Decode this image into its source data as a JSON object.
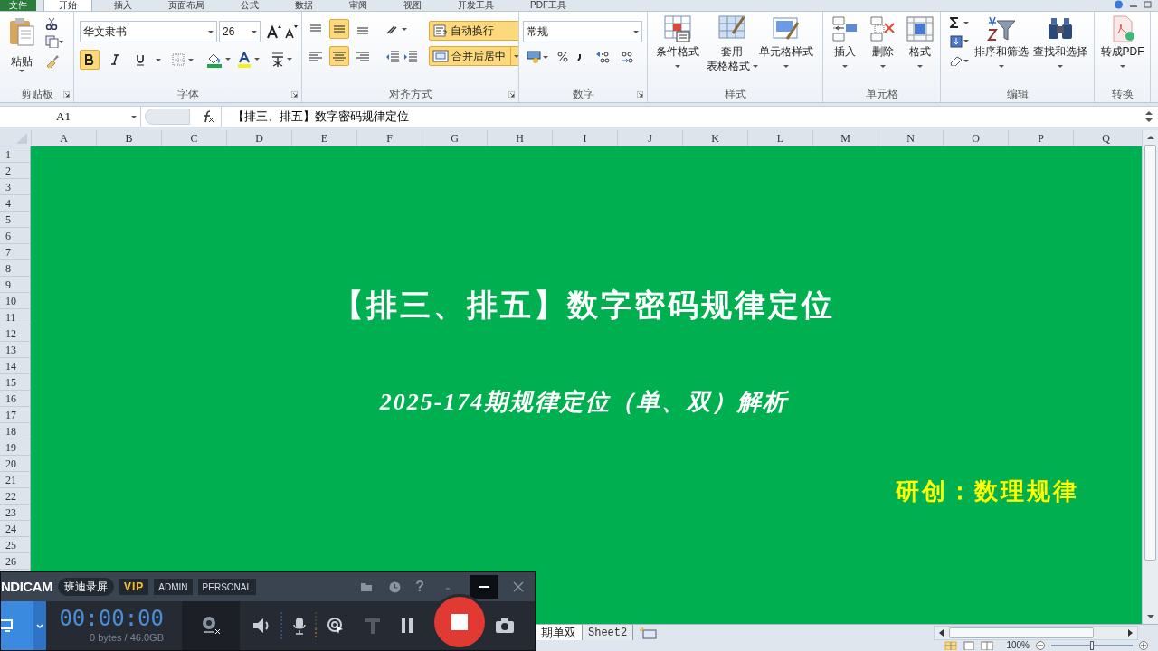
{
  "ribbon_tabs": [
    {
      "label": "文件",
      "selected": false,
      "kind": "file"
    },
    {
      "label": "开始",
      "selected": true,
      "kind": "tab"
    },
    {
      "label": "插入",
      "selected": false,
      "kind": "tab"
    },
    {
      "label": "页面布局",
      "selected": false,
      "kind": "tab"
    },
    {
      "label": "公式",
      "selected": false,
      "kind": "tab"
    },
    {
      "label": "数据",
      "selected": false,
      "kind": "tab"
    },
    {
      "label": "审阅",
      "selected": false,
      "kind": "tab"
    },
    {
      "label": "视图",
      "selected": false,
      "kind": "tab"
    },
    {
      "label": "开发工具",
      "selected": false,
      "kind": "tab"
    },
    {
      "label": "PDF工具",
      "selected": false,
      "kind": "tab"
    }
  ],
  "clipboard": {
    "paste": "粘贴",
    "group": "剪贴板"
  },
  "font": {
    "name": "华文隶书",
    "size": "26",
    "bold": true,
    "italic": false,
    "underline": false,
    "group": "字体"
  },
  "alignment": {
    "vertical": [
      {
        "selected": false
      },
      {
        "selected": true
      },
      {
        "selected": false
      }
    ],
    "horizontal": [
      {
        "selected": false
      },
      {
        "selected": true
      },
      {
        "selected": false
      }
    ],
    "wrap_text": {
      "label": "自动换行",
      "on": true
    },
    "merge": {
      "label": "合并后居中",
      "on": true
    },
    "group": "对齐方式"
  },
  "number": {
    "format": "常规",
    "group": "数字"
  },
  "styles": {
    "buttons": [
      {
        "lines": [
          "条件格式"
        ],
        "kind": "conditional"
      },
      {
        "lines": [
          "套用",
          "表格格式"
        ],
        "kind": "table"
      },
      {
        "lines": [
          "单元格样式"
        ],
        "kind": "cellstyle"
      }
    ],
    "group": "样式"
  },
  "cells": {
    "buttons": [
      {
        "label": "插入",
        "kind": "insert"
      },
      {
        "label": "删除",
        "kind": "delete"
      },
      {
        "label": "格式",
        "kind": "format"
      }
    ],
    "group": "单元格"
  },
  "editing": {
    "buttons": [
      {
        "label": "排序和筛选",
        "kind": "sort"
      },
      {
        "label": "查找和选择",
        "kind": "find"
      }
    ],
    "group": "编辑"
  },
  "convert": {
    "button": "转成PDF",
    "group": "转换"
  },
  "formula_bar": {
    "name_box": "A1",
    "content": "【排三、排五】数字密码规律定位"
  },
  "columns": [
    "A",
    "B",
    "C",
    "D",
    "E",
    "F",
    "G",
    "H",
    "I",
    "J",
    "K",
    "L",
    "M",
    "N",
    "O",
    "P",
    "Q"
  ],
  "rows": [
    "1",
    "2",
    "3",
    "4",
    "5",
    "6",
    "7",
    "8",
    "9",
    "10",
    "11",
    "12",
    "13",
    "14",
    "15",
    "16",
    "17",
    "18",
    "19",
    "20",
    "21",
    "22",
    "23",
    "24",
    "25",
    "26"
  ],
  "sheet": {
    "title": "【排三、排五】数字密码规律定位",
    "subtitle": "2025-174期规律定位（单、双）解析",
    "credit": "研创：数理规律"
  },
  "sheet_tabs": [
    {
      "label": "期单双",
      "selected": true
    },
    {
      "label": "Sheet2",
      "selected": false
    }
  ],
  "status_bar": {
    "zoom": "100%",
    "zoom_level": {
      "level": 0.5
    }
  },
  "recorder": {
    "brand": "NDICAM",
    "name": "班迪录屏",
    "badges": [
      {
        "label": "VIP",
        "kind": "vip"
      },
      {
        "label": "ADMIN",
        "kind": "plain"
      },
      {
        "label": "PERSONAL",
        "kind": "plain"
      }
    ],
    "help": "?",
    "timer": "00:00:00",
    "size": "0 bytes / 46.0GB"
  }
}
